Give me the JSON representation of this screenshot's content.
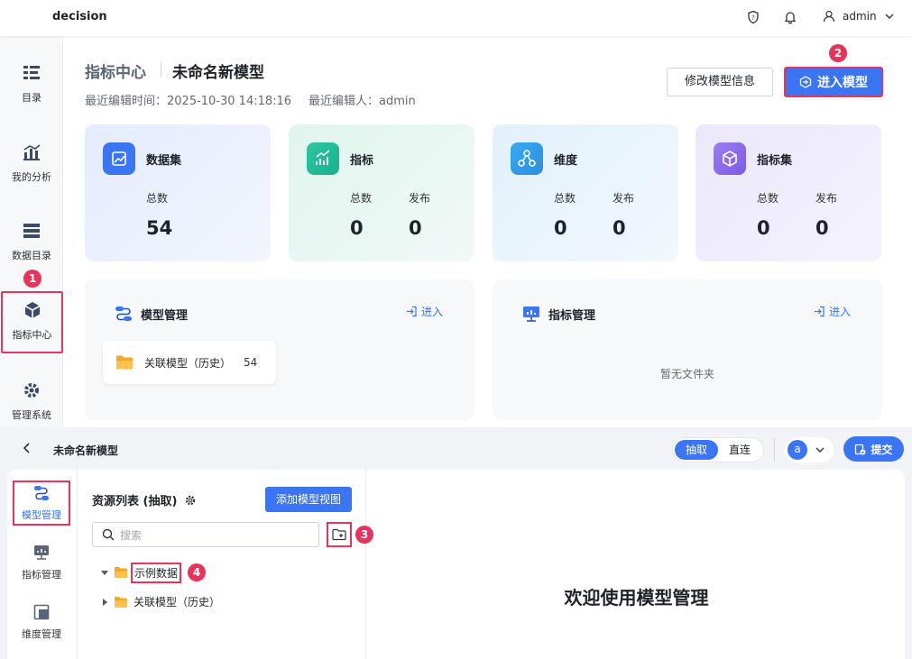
{
  "topbar": {
    "brand": "decision",
    "user": "admin"
  },
  "sidebar": {
    "items": [
      {
        "label": "目录"
      },
      {
        "label": "我的分析"
      },
      {
        "label": "数据目录"
      },
      {
        "label": "指标中心"
      },
      {
        "label": "管理系统"
      }
    ]
  },
  "badges": {
    "b1": "1",
    "b2": "2",
    "b3": "3",
    "b4": "4"
  },
  "header": {
    "section": "指标中心",
    "title": "未命名新模型",
    "edit_time": "最近编辑时间：2025-10-30 14:18:16",
    "editor": "最近编辑人：admin",
    "edit_button": "修改模型信息",
    "enter_button": "进入模型"
  },
  "cards": [
    {
      "title": "数据集",
      "stats": [
        {
          "label": "总数",
          "value": "54"
        }
      ]
    },
    {
      "title": "指标",
      "stats": [
        {
          "label": "总数",
          "value": "0"
        },
        {
          "label": "发布",
          "value": "0"
        }
      ]
    },
    {
      "title": "维度",
      "stats": [
        {
          "label": "总数",
          "value": "0"
        },
        {
          "label": "发布",
          "value": "0"
        }
      ]
    },
    {
      "title": "指标集",
      "stats": [
        {
          "label": "总数",
          "value": "0"
        },
        {
          "label": "发布",
          "value": "0"
        }
      ]
    }
  ],
  "panels": {
    "model": {
      "title": "模型管理",
      "enter": "进入",
      "folder": {
        "name": "关联模型（历史）",
        "count": "54"
      }
    },
    "metric": {
      "title": "指标管理",
      "enter": "进入",
      "empty": "暂无文件夹"
    }
  },
  "editor": {
    "title": "未命名新模型",
    "mode_extract": "抽取",
    "mode_direct": "直连",
    "avatar": "a",
    "submit": "提交",
    "side": [
      {
        "label": "模型管理"
      },
      {
        "label": "指标管理"
      },
      {
        "label": "维度管理"
      }
    ],
    "resource_title": "资源列表 (抽取)",
    "add_view": "添加模型视图",
    "search_placeholder": "搜索",
    "tree": [
      {
        "label": "示例数据",
        "expanded": true
      },
      {
        "label": "关联模型（历史）",
        "expanded": false
      }
    ],
    "welcome": "欢迎使用模型管理"
  },
  "colors": {
    "primary": "#3975f5",
    "highlight": "#e8345a"
  }
}
